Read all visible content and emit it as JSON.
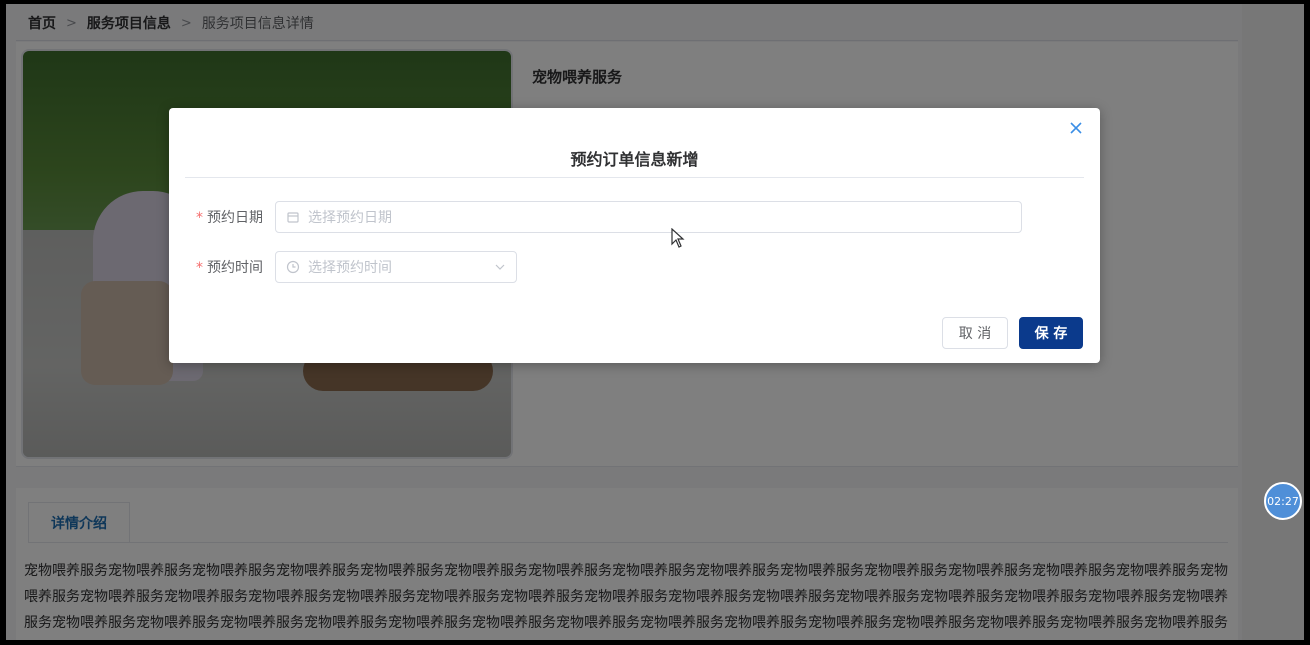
{
  "breadcrumb": {
    "items": [
      "首页",
      "服务项目信息",
      "服务项目信息详情"
    ],
    "separator": ">"
  },
  "service": {
    "title": "宠物喂养服务"
  },
  "detail": {
    "tab_label": "详情介绍",
    "text": "宠物喂养服务宠物喂养服务宠物喂养服务宠物喂养服务宠物喂养服务宠物喂养服务宠物喂养服务宠物喂养服务宠物喂养服务宠物喂养服务宠物喂养服务宠物喂养服务宠物喂养服务宠物喂养服务宠物喂养服务宠物喂养服务宠物喂养服务宠物喂养服务宠物喂养服务宠物喂养服务宠物喂养服务宠物喂养服务宠物喂养服务宠物喂养服务宠物喂养服务宠物喂养服务宠物喂养服务宠物喂养服务宠物喂养服务宠物喂养服务宠物喂养服务宠物喂养服务宠物喂养服务宠物喂养服务宠物喂养服务宠物喂养服务宠物喂养服务宠物喂养服务宠物喂养服务宠物喂养服务宠物喂养服务宠物喂养服务宠物喂养服务宠物喂养服务宠物喂养服务宠物喂养服务宠物喂养服务"
  },
  "timer": {
    "label": "02:27"
  },
  "dialog": {
    "title": "预约订单信息新增",
    "close_icon": "close-icon",
    "fields": {
      "date": {
        "label": "预约日期",
        "required_mark": "*",
        "placeholder": "选择预约日期",
        "icon": "calendar-icon"
      },
      "time": {
        "label": "预约时间",
        "required_mark": "*",
        "placeholder": "选择预约时间",
        "icon": "clock-icon"
      }
    },
    "buttons": {
      "cancel": "取 消",
      "save": "保 存"
    }
  },
  "colors": {
    "primary_button": "#0b3a8c",
    "required": "#f56c6c",
    "accent": "#3a8ee6"
  }
}
